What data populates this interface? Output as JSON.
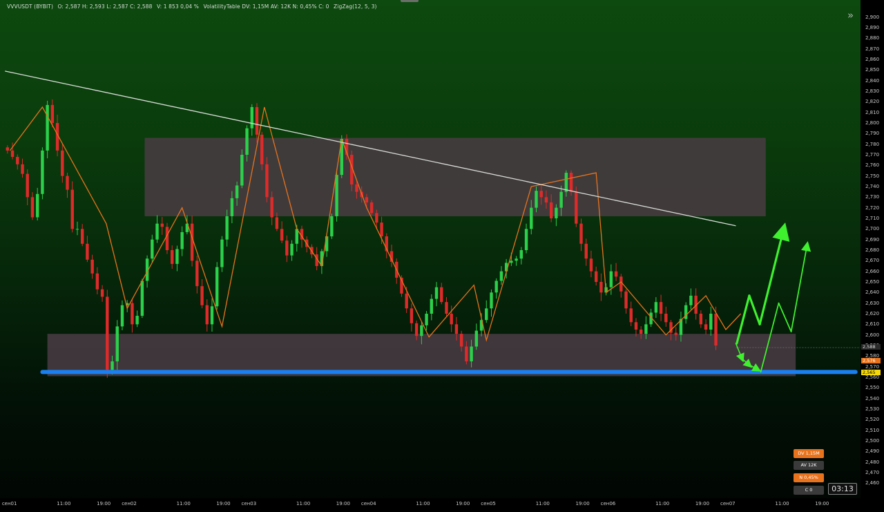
{
  "header": {
    "symbol": "VVVUSDT (BYBIT)",
    "ohlc": "O: 2,587  H: 2,593  L: 2,587  C: 2,588",
    "volume": "V: 1 853  0,04 %",
    "indicator_1": "VolatilityTable  DV: 1,15M  AV: 12K  N: 0,45%  C: 0",
    "indicator_2": "ZigZag(12, 5, 3)"
  },
  "price_axis": {
    "ticks": [
      "2,900",
      "2,890",
      "2,880",
      "2,870",
      "2,860",
      "2,850",
      "2,840",
      "2,830",
      "2,820",
      "2,810",
      "2,800",
      "2,790",
      "2,780",
      "2,770",
      "2,760",
      "2,750",
      "2,740",
      "2,730",
      "2,720",
      "2,710",
      "2,700",
      "2,690",
      "2,680",
      "2,670",
      "2,660",
      "2,650",
      "2,640",
      "2,630",
      "2,620",
      "2,610",
      "2,600",
      "2,590",
      "2,580",
      "2,570",
      "2,560",
      "2,550",
      "2,540",
      "2,530",
      "2,520",
      "2,510",
      "2,500",
      "2,490",
      "2,480",
      "2,470",
      "2,460"
    ],
    "current_price": "2,588",
    "tag_orange": "2,576",
    "tag_yellow": "2,565"
  },
  "time_axis": {
    "ticks": [
      {
        "label": "сен01",
        "v": 0
      },
      {
        "label": "11:00",
        "v": 11
      },
      {
        "label": "19:00",
        "v": 19
      },
      {
        "label": "сен02",
        "v": 24
      },
      {
        "label": "11:00",
        "v": 35
      },
      {
        "label": "19:00",
        "v": 43
      },
      {
        "label": "сен03",
        "v": 48
      },
      {
        "label": "11:00",
        "v": 59
      },
      {
        "label": "19:00",
        "v": 67
      },
      {
        "label": "сен04",
        "v": 72
      },
      {
        "label": "11:00",
        "v": 83
      },
      {
        "label": "19:00",
        "v": 91
      },
      {
        "label": "сен05",
        "v": 96
      },
      {
        "label": "11:00",
        "v": 107
      },
      {
        "label": "19:00",
        "v": 115
      },
      {
        "label": "сен06",
        "v": 120
      },
      {
        "label": "11:00",
        "v": 131
      },
      {
        "label": "19:00",
        "v": 139
      },
      {
        "label": "сен07",
        "v": 144
      },
      {
        "label": "11:00",
        "v": 155
      },
      {
        "label": "19:00",
        "v": 163
      }
    ]
  },
  "badges": {
    "dv": "DV 1,15M",
    "av": "AV 12K",
    "n": "N 0,45%",
    "c": "C 0"
  },
  "timer": "03:13",
  "colors": {
    "bull": "#2bd14a",
    "bear": "#e02a2a",
    "zigzag": "#e8731c",
    "support": "#1a7ff0",
    "projection": "#3ff02f",
    "zone": "#4a3c44",
    "trendline": "#d8dcd8"
  },
  "chart_data": {
    "type": "line",
    "series": [
      {
        "kind": "zigzag",
        "x": [
          0.5,
          7,
          19.8,
          24,
          35,
          43,
          51.5,
          58,
          63,
          67,
          72,
          84.5,
          93.5,
          96,
          105,
          118,
          120,
          123,
          132,
          140,
          144,
          147
        ],
        "y": [
          2.774,
          2.815,
          2.705,
          2.625,
          2.72,
          2.608,
          2.815,
          2.7,
          2.665,
          2.785,
          2.72,
          2.598,
          2.647,
          2.595,
          2.74,
          2.753,
          2.64,
          2.65,
          2.6,
          2.637,
          2.605,
          2.62
        ]
      },
      {
        "kind": "close",
        "x": [
          0,
          1,
          2,
          3,
          4,
          5,
          6,
          7,
          8,
          9,
          10,
          11,
          12,
          13,
          14,
          15,
          16,
          17,
          18,
          19,
          20,
          21,
          22,
          23,
          24,
          25,
          26,
          27,
          28,
          29,
          30,
          31,
          32,
          33,
          34,
          35,
          36,
          37,
          38,
          39,
          40,
          41,
          42,
          43,
          44,
          45,
          46,
          47,
          48,
          49,
          50,
          51,
          52,
          53,
          54,
          55,
          56,
          57,
          58,
          59,
          60,
          61,
          62,
          63,
          64,
          65,
          66,
          67,
          68,
          69,
          70,
          71,
          72,
          73,
          74,
          75,
          76,
          77,
          78,
          79,
          80,
          81,
          82,
          83,
          84,
          85,
          86,
          87,
          88,
          89,
          90,
          91,
          92,
          93,
          94,
          95,
          96,
          97,
          98,
          99,
          100,
          101,
          102,
          103,
          104,
          105,
          106,
          107,
          108,
          109,
          110,
          111,
          112,
          113,
          114,
          115,
          116,
          117,
          118,
          119,
          120,
          121,
          122,
          123,
          124,
          125,
          126,
          127,
          128,
          129,
          130,
          131,
          132,
          133,
          134,
          135,
          136,
          137,
          138,
          139,
          140,
          141,
          142
        ],
        "y": [
          2.774,
          2.768,
          2.761,
          2.752,
          2.73,
          2.711,
          2.733,
          2.774,
          2.817,
          2.8,
          2.774,
          2.75,
          2.737,
          2.7,
          2.7,
          2.686,
          2.671,
          2.658,
          2.643,
          2.636,
          2.567,
          2.575,
          2.608,
          2.628,
          2.63,
          2.61,
          2.618,
          2.651,
          2.672,
          2.69,
          2.705,
          2.702,
          2.68,
          2.667,
          2.681,
          2.697,
          2.705,
          2.67,
          2.646,
          2.628,
          2.61,
          2.627,
          2.664,
          2.69,
          2.712,
          2.729,
          2.741,
          2.77,
          2.795,
          2.815,
          2.789,
          2.761,
          2.73,
          2.711,
          2.7,
          2.689,
          2.675,
          2.686,
          2.7,
          2.69,
          2.683,
          2.676,
          2.665,
          2.679,
          2.693,
          2.712,
          2.751,
          2.785,
          2.77,
          2.742,
          2.735,
          2.73,
          2.725,
          2.715,
          2.706,
          2.693,
          2.679,
          2.669,
          2.654,
          2.639,
          2.625,
          2.611,
          2.599,
          2.609,
          2.62,
          2.634,
          2.645,
          2.631,
          2.62,
          2.61,
          2.601,
          2.589,
          2.575,
          2.589,
          2.604,
          2.614,
          2.625,
          2.64,
          2.651,
          2.66,
          2.668,
          2.67,
          2.672,
          2.68,
          2.7,
          2.72,
          2.736,
          2.73,
          2.725,
          2.71,
          2.72,
          2.735,
          2.753,
          2.735,
          2.705,
          2.686,
          2.672,
          2.66,
          2.65,
          2.64,
          2.645,
          2.66,
          2.655,
          2.641,
          2.625,
          2.612,
          2.605,
          2.601,
          2.61,
          2.621,
          2.631,
          2.62,
          2.612,
          2.602,
          2.6,
          2.615,
          2.628,
          2.637,
          2.62,
          2.61,
          2.605,
          2.62,
          2.59
        ]
      },
      {
        "kind": "trendline",
        "x": [
          -0.5,
          146
        ],
        "y": [
          2.849,
          2.703
        ]
      },
      {
        "kind": "support",
        "x": [
          7,
          170
        ],
        "y": [
          2.565,
          2.565
        ]
      },
      {
        "kind": "projection",
        "x": [
          146,
          148,
          152,
          154,
          158,
          160
        ],
        "y": [
          2.59,
          2.578,
          2.567,
          2.605,
          2.605,
          2.7
        ]
      }
    ],
    "zones": [
      {
        "x0": 27.5,
        "x1": 152,
        "y0": 2.712,
        "y1": 2.786
      },
      {
        "x0": 8,
        "x1": 158,
        "y0": 2.561,
        "y1": 2.601
      }
    ],
    "xlabel": "",
    "ylabel": "",
    "ylim": [
      2.455,
      2.905
    ],
    "xlim": [
      -1.5,
      171
    ],
    "grid": false,
    "last_price": 2.588
  }
}
